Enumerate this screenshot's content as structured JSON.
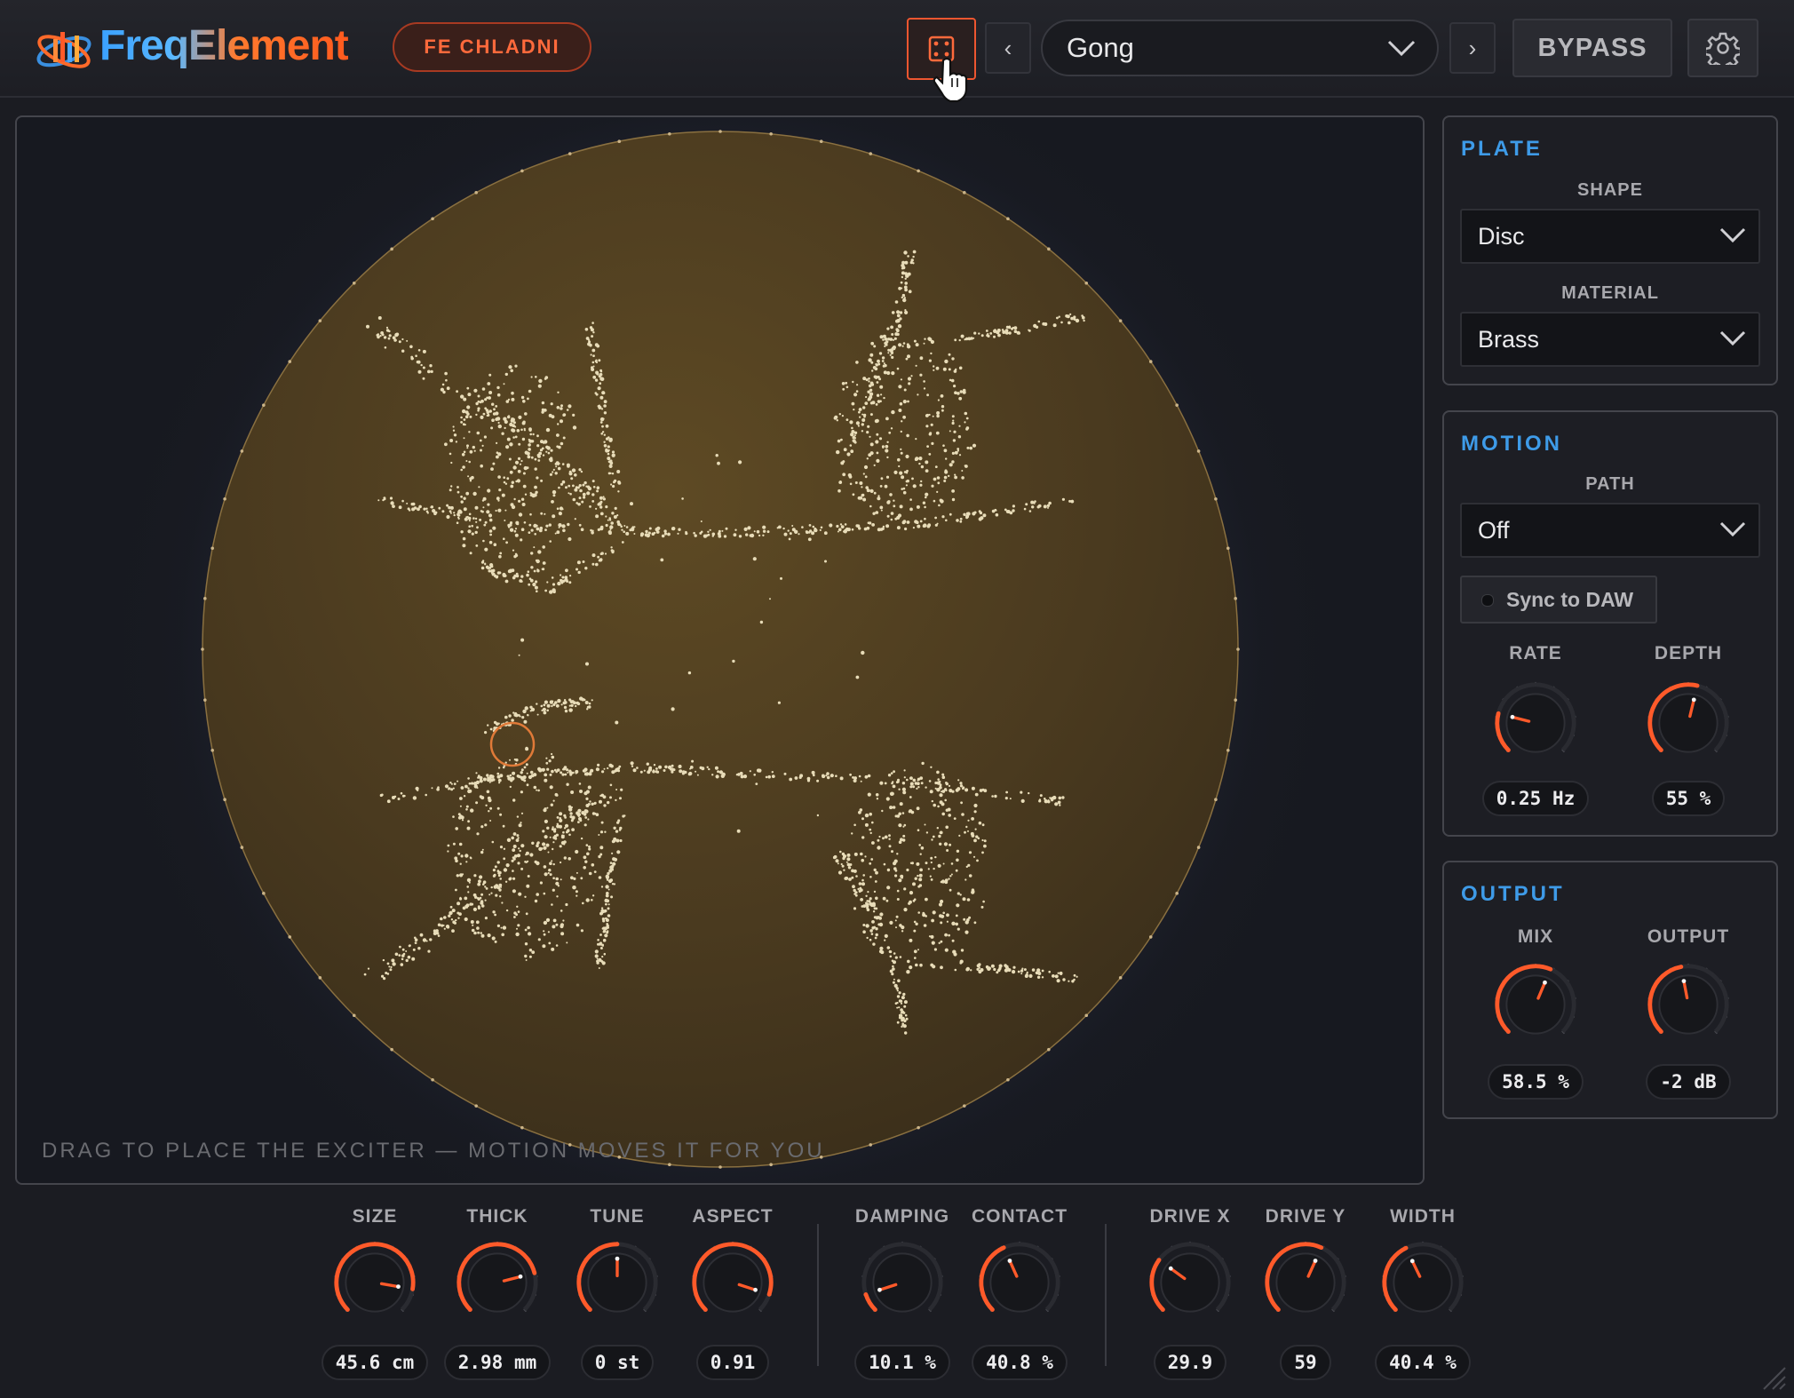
{
  "header": {
    "logo_text": "FreqElement",
    "badge": "FE CHLADNI",
    "preset_name": "Gong",
    "bypass_label": "BYPASS",
    "prev_glyph": "‹",
    "next_glyph": "›"
  },
  "icons": {
    "logo": "logo-icon",
    "randomize": "dice-icon",
    "settings": "gear-icon",
    "dropdown": "chevron-down-icon",
    "cursor": "hand-pointer-icon"
  },
  "plate_view": {
    "hint": "DRAG TO PLACE THE EXCITER — MOTION MOVES IT FOR YOU"
  },
  "plate_panel": {
    "title": "PLATE",
    "shape_label": "SHAPE",
    "shape_value": "Disc",
    "material_label": "MATERIAL",
    "material_value": "Brass"
  },
  "motion_panel": {
    "title": "MOTION",
    "path_label": "PATH",
    "path_value": "Off",
    "sync_label": "Sync to DAW",
    "sync_on": false,
    "knobs": [
      {
        "label": "RATE",
        "value": "0.25 Hz",
        "fraction": 0.22
      },
      {
        "label": "DEPTH",
        "value": "55 %",
        "fraction": 0.55
      }
    ]
  },
  "output_panel": {
    "title": "OUTPUT",
    "knobs": [
      {
        "label": "MIX",
        "value": "58.5 %",
        "fraction": 0.585
      },
      {
        "label": "OUTPUT",
        "value": "-2 dB",
        "fraction": 0.46
      }
    ]
  },
  "bottom_knobs": [
    {
      "label": "SIZE",
      "value": "45.6 cm",
      "fraction": 0.87
    },
    {
      "label": "THICK",
      "value": "2.98 mm",
      "fraction": 0.78
    },
    {
      "label": "TUNE",
      "value": "0 st",
      "fraction": 0.5
    },
    {
      "label": "ASPECT",
      "value": "0.91",
      "fraction": 0.9
    },
    {
      "label": "DAMPING",
      "value": "10.1 %",
      "fraction": 0.1
    },
    {
      "label": "CONTACT",
      "value": "40.8 %",
      "fraction": 0.41
    },
    {
      "label": "DRIVE X",
      "value": "29.9",
      "fraction": 0.3
    },
    {
      "label": "DRIVE Y",
      "value": "59",
      "fraction": 0.59
    },
    {
      "label": "WIDTH",
      "value": "40.4 %",
      "fraction": 0.404
    }
  ],
  "colors": {
    "accent": "#ff5a2a",
    "panel_title": "#3e9be8",
    "plate": "#5a4520",
    "sand": "#e8dcb8"
  }
}
